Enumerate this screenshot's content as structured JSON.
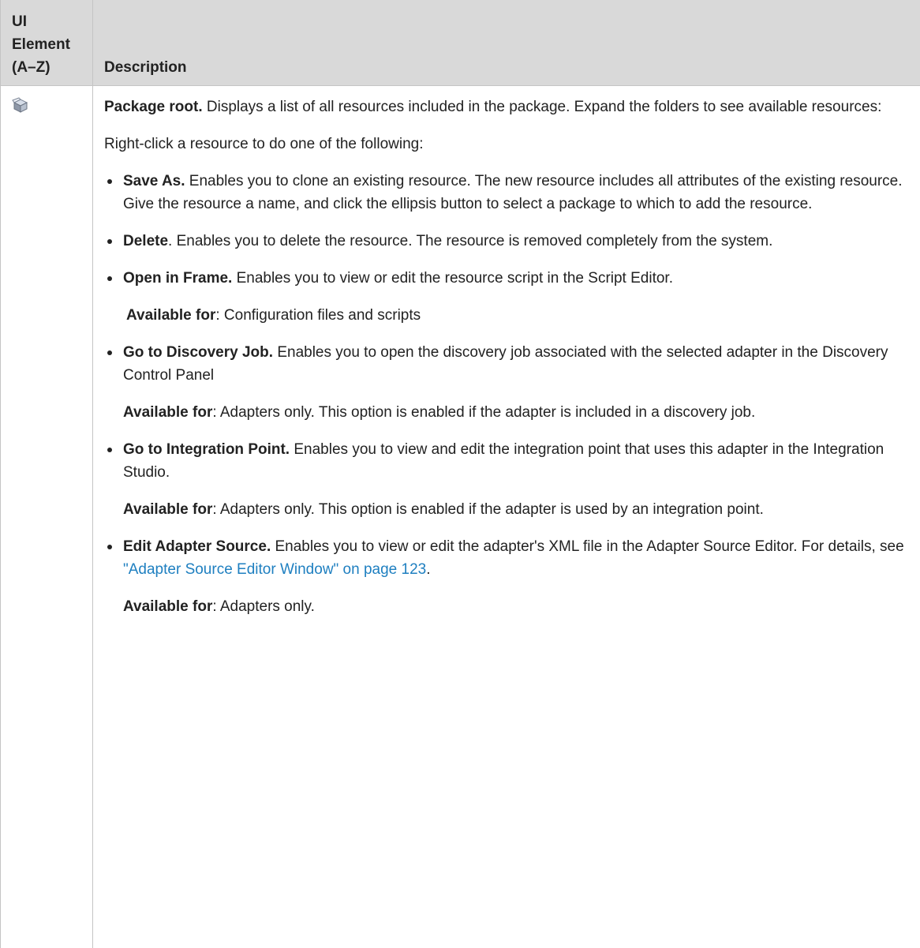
{
  "header": {
    "col1": "UI Element (A–Z)",
    "col2": "Description"
  },
  "row": {
    "icon": "package-icon",
    "intro_bold": "Package root.",
    "intro_text": " Displays a list of all resources included in the package. Expand the folders to see available resources:",
    "rightclick_text": "Right-click a resource to do one of the following:",
    "items": [
      {
        "title": "Save As.",
        "text": " Enables you to clone an existing resource. The new resource includes all attributes of the existing resource. Give the resource a name, and click the ellipsis button to select a package to which to add the resource."
      },
      {
        "title": "Delete",
        "text": ". Enables you to delete the resource. The resource is removed completely from the system."
      },
      {
        "title": "Open in Frame.",
        "text": " Enables you to view or edit the resource script in the Script Editor.",
        "avail_label": "Available for",
        "avail_text": ": Configuration files and scripts"
      },
      {
        "title": "Go to Discovery Job.",
        "text": " Enables you to open the discovery job associated with the selected adapter in the Discovery Control Panel",
        "avail_label": "Available for",
        "avail_text": ": Adapters only. This option is enabled if the adapter is included in a discovery job."
      },
      {
        "title": "Go to Integration Point.",
        "text": " Enables you to view and edit the integration point that uses this adapter in the Integration Studio.",
        "avail_label": "Available for",
        "avail_text": ": Adapters only. This option is enabled if the adapter is used by an integration point."
      },
      {
        "title": "Edit Adapter Source.",
        "text": " Enables you to view or edit the adapter's XML file in the Adapter Source Editor. For details, see ",
        "link": "\"Adapter Source Editor Window\" on page 123",
        "text_after": ".",
        "avail_label": "Available for",
        "avail_text": ": Adapters only."
      }
    ]
  }
}
